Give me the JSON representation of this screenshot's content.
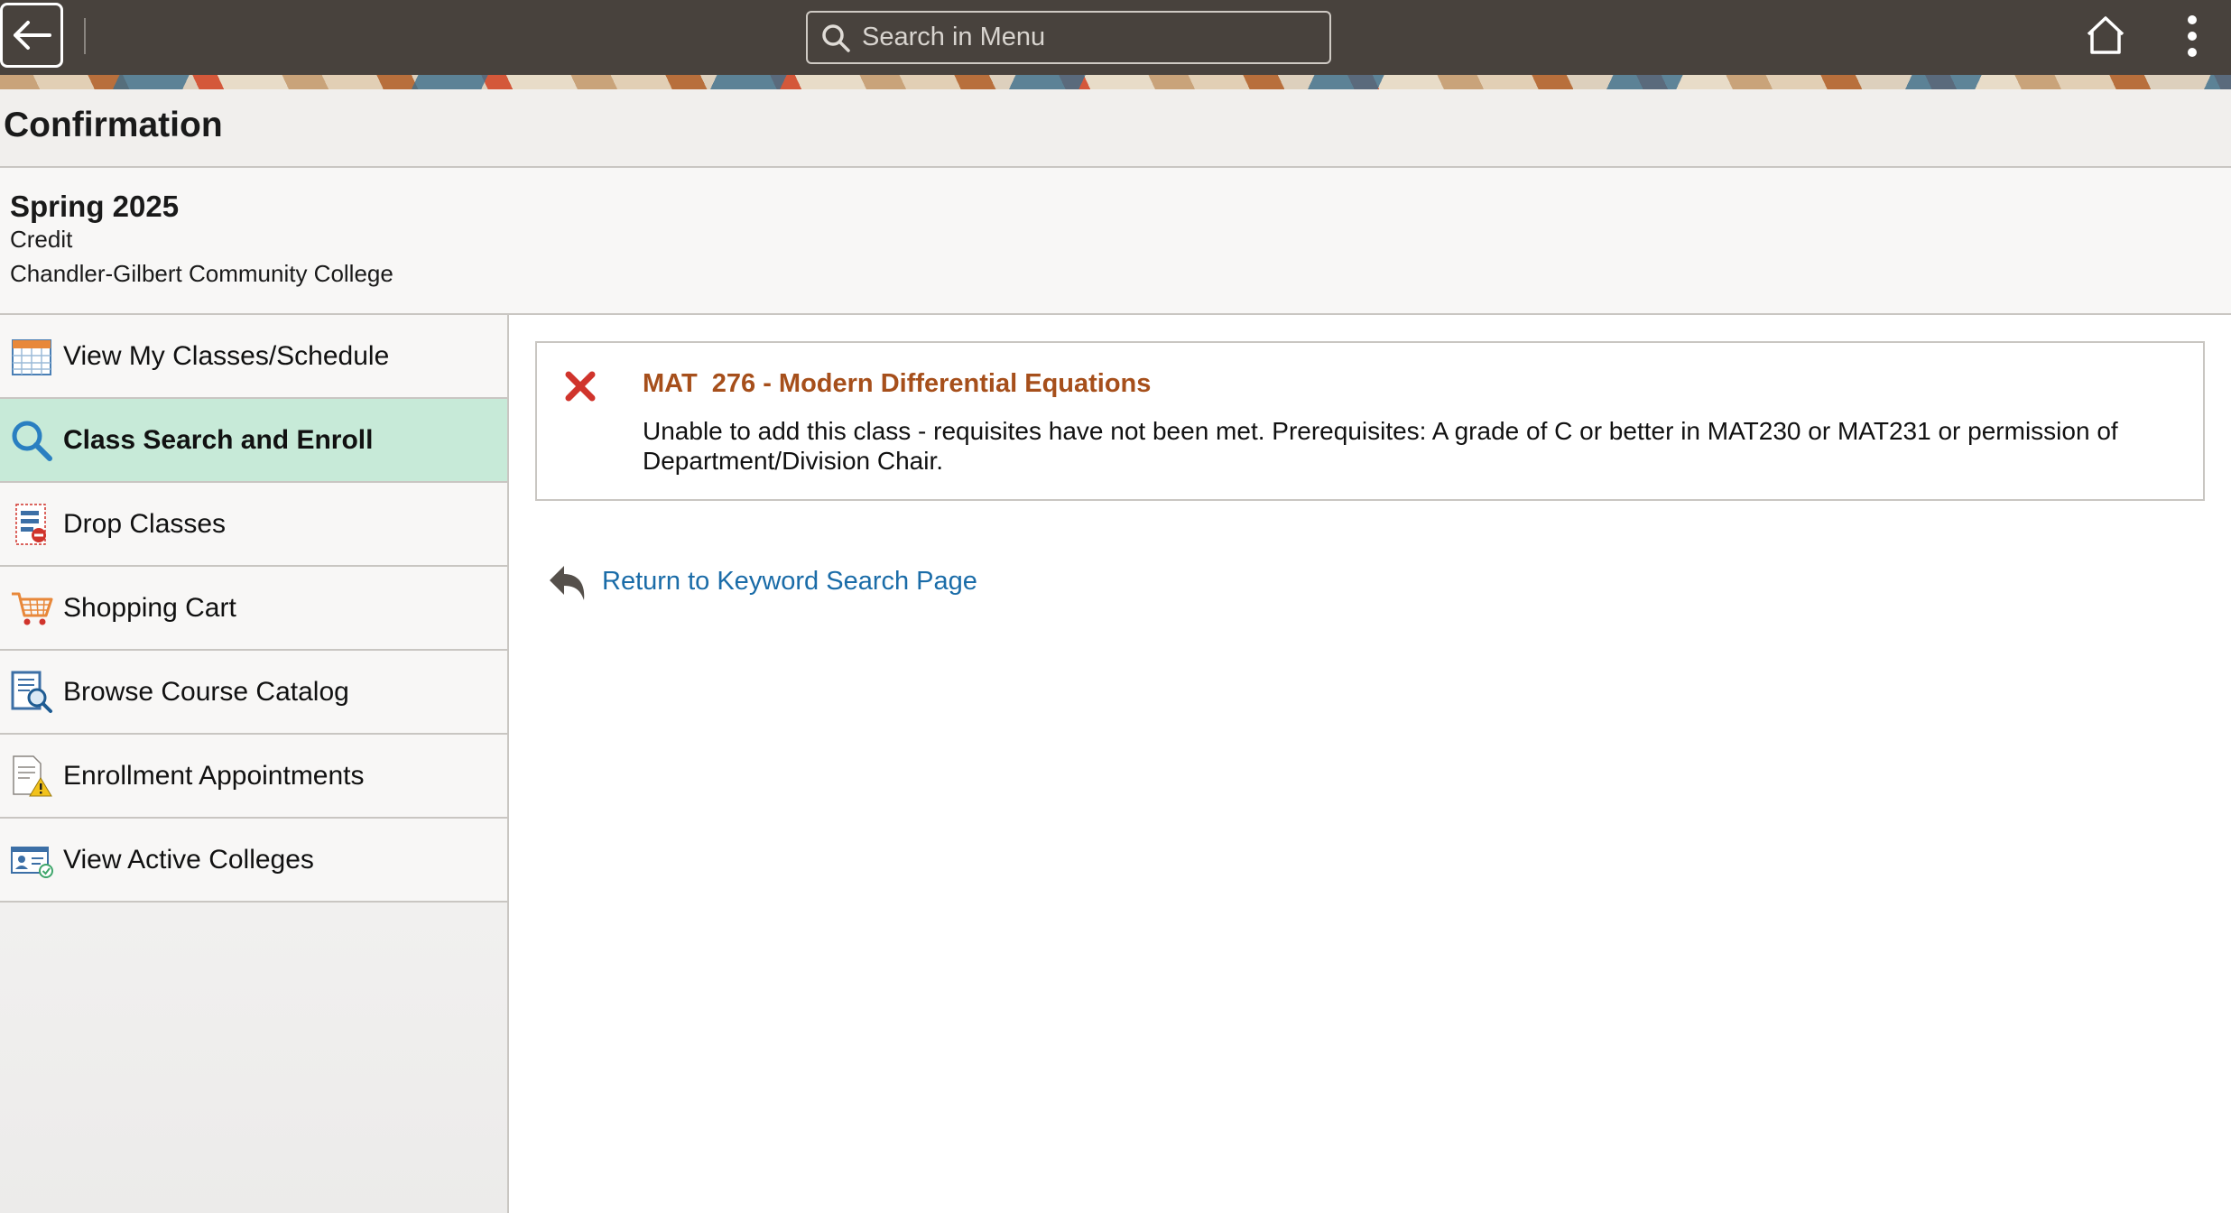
{
  "header": {
    "search_placeholder": "Search in Menu"
  },
  "page": {
    "title": "Confirmation"
  },
  "term": {
    "name": "Spring 2025",
    "career": "Credit",
    "institution": "Chandler-Gilbert Community College"
  },
  "sidebar": {
    "items": [
      {
        "label": "View My Classes/Schedule",
        "icon": "calendar-icon",
        "active": false
      },
      {
        "label": "Class Search and Enroll",
        "icon": "search-icon",
        "active": true
      },
      {
        "label": "Drop Classes",
        "icon": "drop-list-icon",
        "active": false
      },
      {
        "label": "Shopping Cart",
        "icon": "cart-icon",
        "active": false
      },
      {
        "label": "Browse Course Catalog",
        "icon": "catalog-search-icon",
        "active": false
      },
      {
        "label": "Enrollment Appointments",
        "icon": "document-warning-icon",
        "active": false
      },
      {
        "label": "View Active Colleges",
        "icon": "id-card-icon",
        "active": false
      }
    ]
  },
  "message": {
    "title": "MAT  276 - Modern Differential Equations",
    "text": "Unable to add this class - requisites have not been met. Prerequisites: A grade of C or better in MAT230 or MAT231 or permission of Department/Division Chair.",
    "status_icon": "error-x-icon",
    "status_color": "#d0342c"
  },
  "actions": {
    "return_label": "Return to Keyword Search Page"
  },
  "colors": {
    "header_bg": "#48423d",
    "active_nav_bg": "#c7ead8",
    "link": "#1a6ca8",
    "course_title": "#a64f1b"
  }
}
